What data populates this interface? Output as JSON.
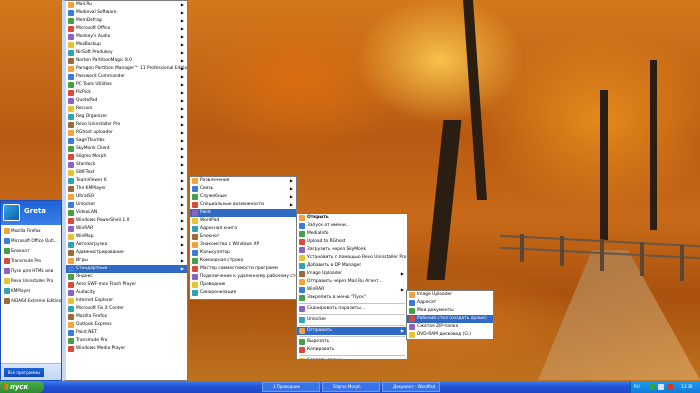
{
  "colors": {
    "taskbar": "#2456d8",
    "highlight": "#316ac5",
    "start_green": "#2f8a2f"
  },
  "start_menu": {
    "user_name": "Greta",
    "pinned": [
      {
        "label": "Mozilla Firefox",
        "icon": "firefox-icon"
      },
      {
        "label": "Microsoft Office Outl...",
        "icon": "outlook-icon"
      },
      {
        "label": "Блокнот",
        "icon": "notepad-icon"
      },
      {
        "label": "Transmute Pro",
        "icon": "transmute-icon"
      },
      {
        "label": "Пуск для HTML или",
        "icon": "html-icon"
      },
      {
        "label": "Revo Uninstaller Pro",
        "icon": "revo-icon"
      },
      {
        "label": "KMPlayer",
        "icon": "kmplayer-icon"
      },
      {
        "label": "AIDA64 Extreme Edition",
        "icon": "aida64-icon"
      }
    ],
    "all_programs": "Все программы"
  },
  "programs_menu": [
    {
      "label": "Mail.Ru"
    },
    {
      "label": "Medieval Software"
    },
    {
      "label": "MemDefrag"
    },
    {
      "label": "Microsoft Office"
    },
    {
      "label": "Monkey's Audio"
    },
    {
      "label": "MozBackup"
    },
    {
      "label": "NirSoft Produkey"
    },
    {
      "label": "Norton PartitionMagic 8.0"
    },
    {
      "label": "Paragon Partition Manager™ 11 Professional Edition"
    },
    {
      "label": "Password Commander"
    },
    {
      "label": "PC Tools Utilities"
    },
    {
      "label": "PicPick"
    },
    {
      "label": "QuotePad"
    },
    {
      "label": "Recuva"
    },
    {
      "label": "Reg Organizer"
    },
    {
      "label": "Revo Uninstaller Pro"
    },
    {
      "label": "RGhost uploader"
    },
    {
      "label": "SageThumbs"
    },
    {
      "label": "SkyMonk Client"
    },
    {
      "label": "Sliqmo Morph"
    },
    {
      "label": "Stardock"
    },
    {
      "label": "SWFText"
    },
    {
      "label": "TeamViewer 6"
    },
    {
      "label": "The KMPlayer"
    },
    {
      "label": "UltraISO"
    },
    {
      "label": "Unlocker"
    },
    {
      "label": "VideoLAN"
    },
    {
      "label": "Windows PowerShell 1.0"
    },
    {
      "label": "WinRAR"
    },
    {
      "label": "WinMap"
    },
    {
      "label": "Автозагрузка"
    },
    {
      "label": "Администрирование"
    },
    {
      "label": "Игры"
    },
    {
      "label": "Стандартные",
      "selected": true
    },
    {
      "label": "Яндекс"
    },
    {
      "label": "Aero SWF-mov Flash Player"
    },
    {
      "label": "Audacity"
    },
    {
      "label": "Internet Explorer"
    },
    {
      "label": "Microsoft Fix it Center"
    },
    {
      "label": "Mozilla Firefox"
    },
    {
      "label": "Outlook Express"
    },
    {
      "label": "Paint.NET"
    },
    {
      "label": "Transmute Pro"
    },
    {
      "label": "Windows Media Player"
    }
  ],
  "accessories_menu": [
    {
      "label": "Развлечения",
      "icon": "folder-icon"
    },
    {
      "label": "Связь",
      "icon": "folder-icon"
    },
    {
      "label": "Служебные",
      "icon": "folder-icon"
    },
    {
      "label": "Специальные возможности",
      "icon": "folder-icon"
    },
    {
      "label": "Paint",
      "icon": "paint-icon",
      "selected": true
    },
    {
      "label": "WordPad",
      "icon": "wordpad-icon"
    },
    {
      "label": "Адресная книга",
      "icon": "address-book-icon"
    },
    {
      "label": "Блокнот",
      "icon": "notepad-icon"
    },
    {
      "label": "Знакомство с Windows XP",
      "icon": "tour-icon"
    },
    {
      "label": "Калькулятор",
      "icon": "calculator-icon"
    },
    {
      "label": "Командная строка",
      "icon": "cmd-icon"
    },
    {
      "label": "Мастер совместимости программ",
      "icon": "wizard-icon"
    },
    {
      "label": "Подключение к удаленному рабочему столу",
      "icon": "remote-desktop-icon"
    },
    {
      "label": "Проводник",
      "icon": "explorer-icon"
    },
    {
      "label": "Синхронизация",
      "icon": "sync-icon"
    }
  ],
  "context_menu": [
    {
      "label": "Открыть",
      "bold": true
    },
    {
      "label": "Запуск от имени..."
    },
    {
      "label": "MediaInfo"
    },
    {
      "label": "Upload to RGhost"
    },
    {
      "label": "Загрузить через SkyMonk"
    },
    {
      "label": "Установить с помощью Revo Uninstaller Pro"
    },
    {
      "label": "Добавить в DP Manager"
    },
    {
      "label": "Image Uploader"
    },
    {
      "label": "Отправить через Mail.Ru Агент..."
    },
    {
      "label": "WinRAR"
    },
    {
      "label": "Закрепить в меню \"Пуск\""
    },
    {
      "sep": true
    },
    {
      "label": "Сканировать паразиты..."
    },
    {
      "sep": true
    },
    {
      "label": "Unlocker"
    },
    {
      "sep": true
    },
    {
      "label": "Отправить",
      "selected": true
    },
    {
      "sep": true
    },
    {
      "label": "Вырезать"
    },
    {
      "label": "Копировать"
    },
    {
      "sep": true
    },
    {
      "label": "Создать ярлык"
    },
    {
      "label": "Удалить"
    },
    {
      "label": "Переименовать"
    },
    {
      "sep": true
    },
    {
      "label": "Сортировать по имени"
    },
    {
      "label": "Свойства"
    }
  ],
  "sendto_menu": [
    {
      "label": "Image Uploader",
      "icon": "image-uploader-icon"
    },
    {
      "label": "Адресат",
      "icon": "mail-recipient-icon"
    },
    {
      "label": "Мои документы",
      "icon": "my-documents-icon"
    },
    {
      "label": "Рабочий стол (создать ярлык)",
      "icon": "desktop-icon",
      "selected": true
    },
    {
      "label": "Сжатая ZIP-папка",
      "icon": "zip-folder-icon"
    },
    {
      "label": "DVD-RAM дисковод (G:)",
      "icon": "dvd-drive-icon"
    }
  ],
  "taskbar": {
    "start_label": "пуск",
    "tasks": [
      "3 Проводник",
      "Sliqmo Morph",
      "Документ - WordPad"
    ],
    "language": "RU",
    "clock": "13:38"
  }
}
